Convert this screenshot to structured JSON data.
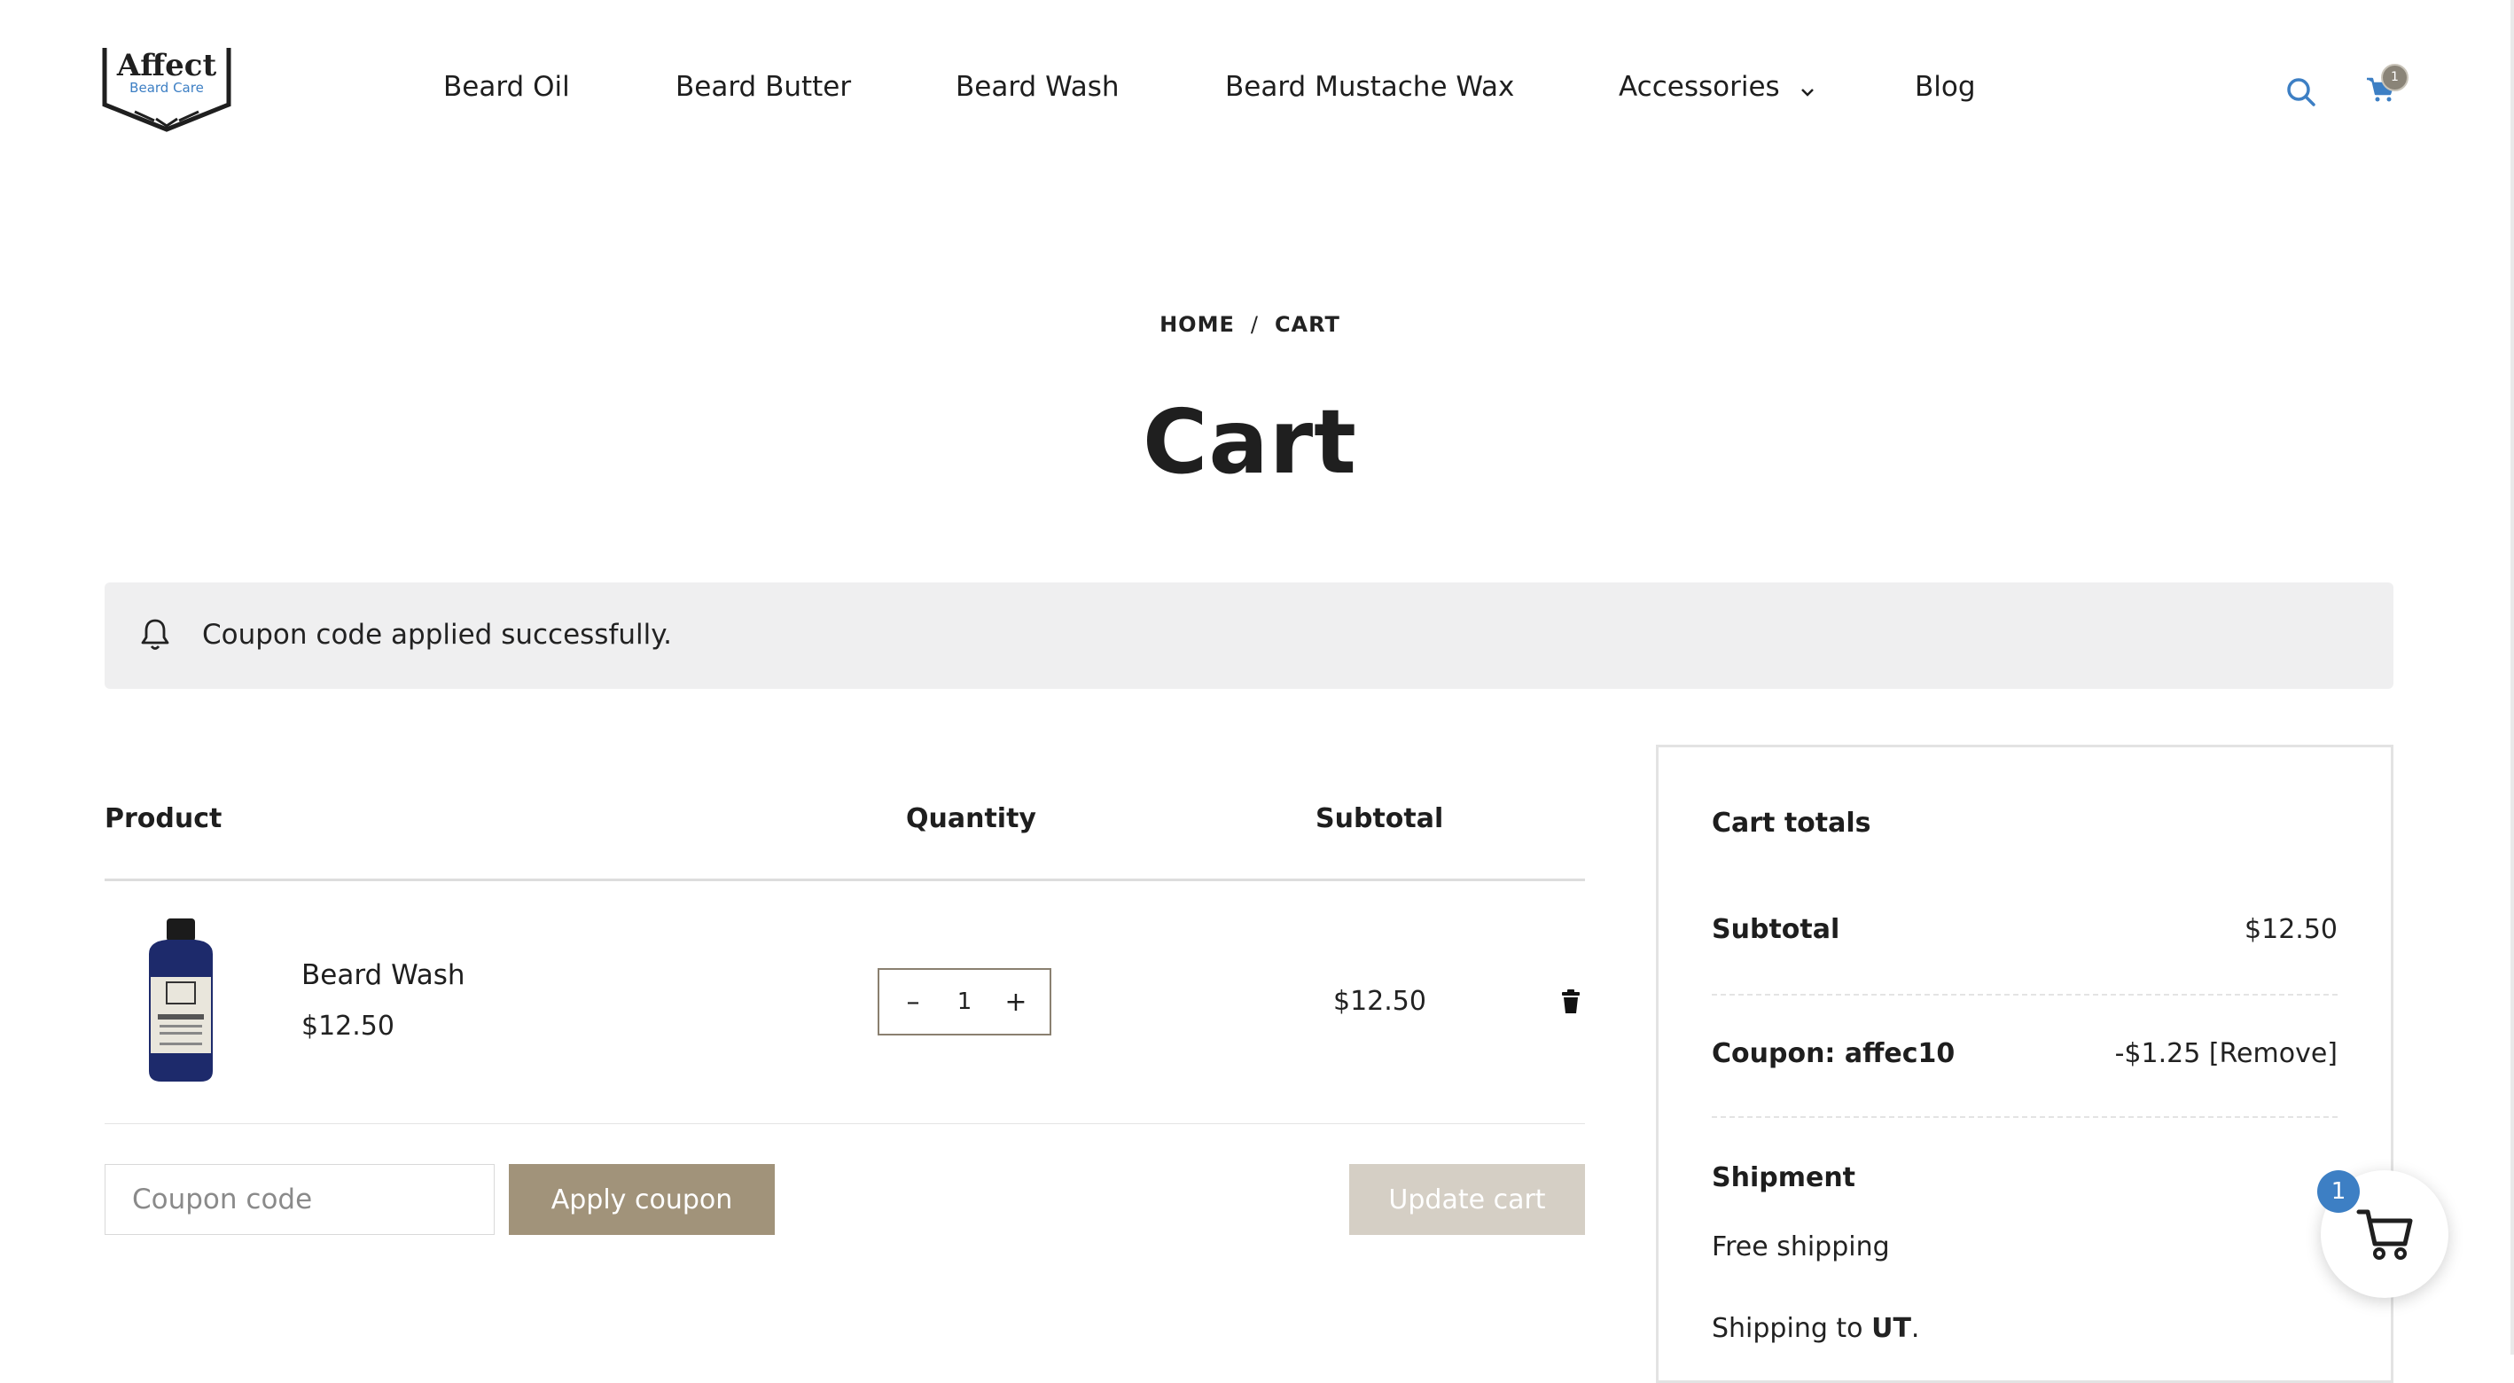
{
  "logo": {
    "name": "Affect",
    "tagline": "Beard Care"
  },
  "nav": [
    {
      "label": "Beard Oil"
    },
    {
      "label": "Beard Butter"
    },
    {
      "label": "Beard Wash"
    },
    {
      "label": "Beard Mustache Wax"
    },
    {
      "label": "Accessories",
      "has_dropdown": true
    },
    {
      "label": "Blog"
    }
  ],
  "header_icons": {
    "search": "search-icon",
    "cart": "cart-icon"
  },
  "breadcrumb": {
    "home": "HOME",
    "separator": "/",
    "current": "CART"
  },
  "page_title": "Cart",
  "notice": {
    "icon": "bell-icon",
    "text": "Coupon code applied successfully."
  },
  "cart_table": {
    "headers": {
      "product": "Product",
      "quantity": "Quantity",
      "subtotal": "Subtotal"
    },
    "items": [
      {
        "name": "Beard Wash",
        "price": "$12.50",
        "quantity": "1",
        "subtotal": "$12.50"
      }
    ],
    "qty_minus": "–",
    "qty_plus": "+"
  },
  "coupon": {
    "placeholder": "Coupon code",
    "apply_label": "Apply coupon",
    "update_label": "Update cart"
  },
  "totals": {
    "heading": "Cart totals",
    "subtotal_label": "Subtotal",
    "subtotal_value": "$12.50",
    "coupon_label": "Coupon: affec10",
    "coupon_value": "-$1.25",
    "coupon_remove": "[Remove]",
    "shipment_label": "Shipment",
    "shipping_method": "Free shipping",
    "shipping_to_prefix": "Shipping to",
    "shipping_to_region": "UT",
    "shipping_to_suffix": "."
  },
  "floating_cart": {
    "count": "1"
  },
  "colors": {
    "accent": "#a1937a",
    "accent_disabled": "#d5cfc5",
    "badge_blue": "#3d7fc4",
    "icon_blue": "#3d7fc4",
    "notice_bg": "#efeff0"
  }
}
